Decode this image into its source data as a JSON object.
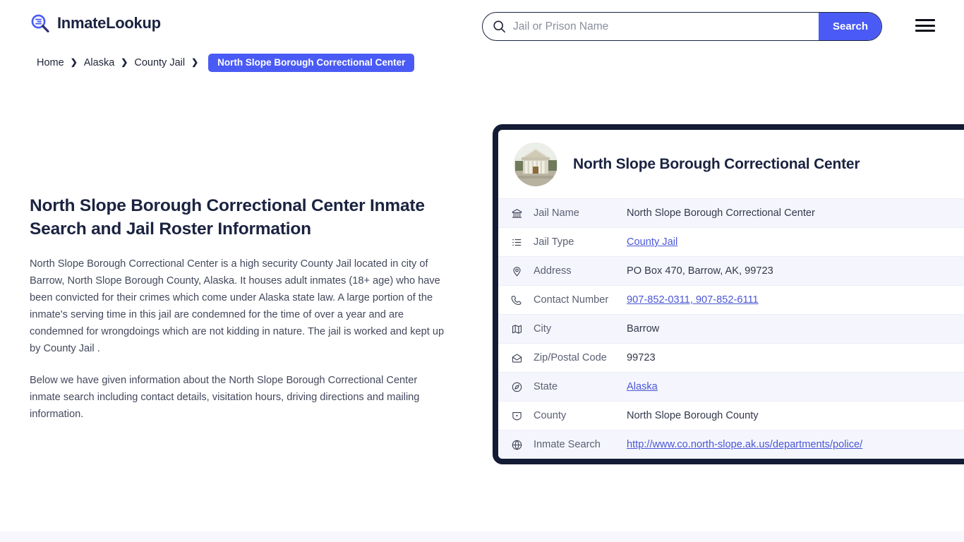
{
  "header": {
    "brand_name": "InmateLookup",
    "brand_icon": "magnifier-list-icon",
    "menu_icon": "hamburger-menu-icon",
    "accent_color": "#4a5bf5",
    "dark_color": "#141b34"
  },
  "search": {
    "icon": "search-icon",
    "placeholder": "Jail or Prison Name",
    "value": "",
    "button_label": "Search"
  },
  "breadcrumb": {
    "items": [
      {
        "label": "Home",
        "current": false
      },
      {
        "label": "Alaska",
        "current": false
      },
      {
        "label": "County Jail",
        "current": false
      }
    ],
    "current": "North Slope Borough Correctional Center",
    "separator": "❯"
  },
  "main": {
    "title": "North Slope Borough Correctional Center Inmate Search and Jail Roster Information",
    "paragraphs": [
      "North Slope Borough Correctional Center is a high security County Jail located in city of Barrow, North Slope Borough County, Alaska. It houses adult inmates (18+ age) who have been convicted for their crimes which come under Alaska state law. A large portion of the inmate's serving time in this jail are condemned for the time of over a year and are condemned for wrongdoings which are not kidding in nature. The jail is worked and kept up by County Jail .",
      "Below we have given information about the North Slope Borough Correctional Center inmate search including contact details, visitation hours, driving directions and mailing information."
    ]
  },
  "card": {
    "photo_icon": "courthouse-building-photo",
    "title": "North Slope Borough Correctional Center",
    "rows": [
      {
        "icon": "bank-building-icon",
        "label": "Jail Name",
        "value": "North Slope Borough Correctional Center",
        "link": false
      },
      {
        "icon": "list-icon",
        "label": "Jail Type",
        "value": "County Jail",
        "link": true
      },
      {
        "icon": "map-pin-icon",
        "label": "Address",
        "value": "PO Box 470, Barrow, AK, 99723",
        "link": false
      },
      {
        "icon": "phone-icon",
        "label": "Contact Number",
        "value": "907-852-0311, 907-852-6111",
        "link": true
      },
      {
        "icon": "map-folded-icon",
        "label": "City",
        "value": "Barrow",
        "link": false
      },
      {
        "icon": "mail-open-icon",
        "label": "Zip/Postal Code",
        "value": "99723",
        "link": false
      },
      {
        "icon": "globe-compass-icon",
        "label": "State",
        "value": "Alaska",
        "link": true
      },
      {
        "icon": "county-shield-icon",
        "label": "County",
        "value": "North Slope Borough County",
        "link": false
      },
      {
        "icon": "globe-icon",
        "label": "Inmate Search",
        "value": "http://www.co.north-slope.ak.us/departments/police/",
        "link": true
      }
    ]
  }
}
